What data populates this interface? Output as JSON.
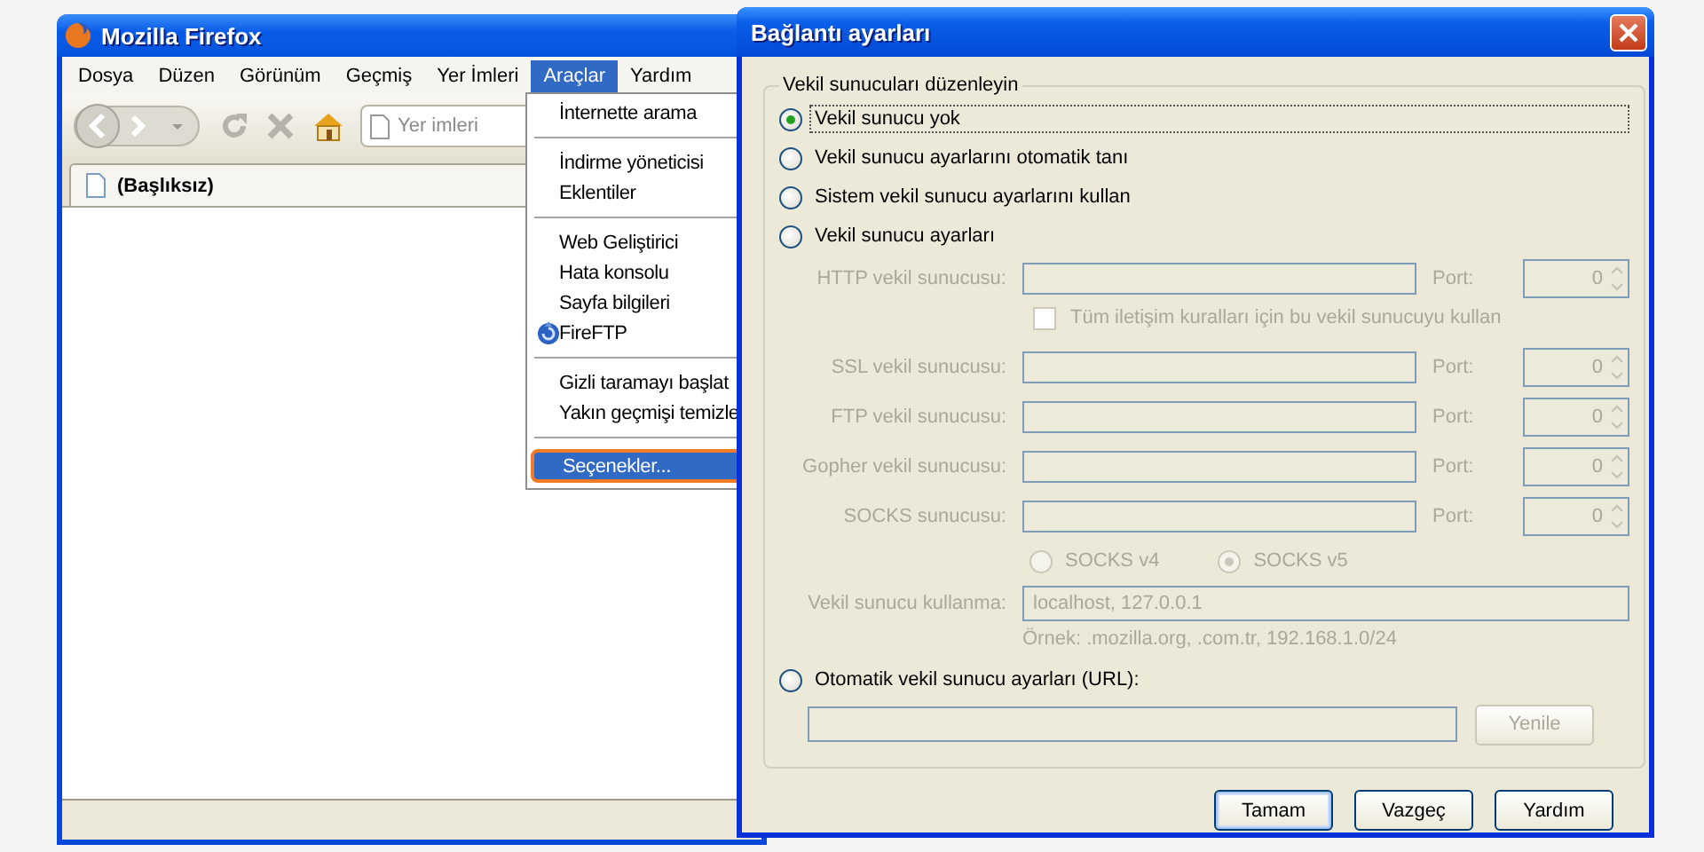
{
  "browser": {
    "title": "Mozilla Firefox",
    "menu": [
      {
        "label": "Dosya",
        "selected": false
      },
      {
        "label": "Düzen",
        "selected": false
      },
      {
        "label": "Görünüm",
        "selected": false
      },
      {
        "label": "Geçmiş",
        "selected": false
      },
      {
        "label": "Yer İmleri",
        "selected": false
      },
      {
        "label": "Araçlar",
        "selected": true
      },
      {
        "label": "Yardım",
        "selected": false
      }
    ],
    "address": {
      "placeholder": "Yer imleri"
    },
    "tabs": [
      {
        "label": "(Başlıksız)",
        "selected": true
      }
    ],
    "tools_menu": [
      {
        "kind": "item",
        "label": "İnternette arama",
        "selected": false
      },
      {
        "kind": "separator"
      },
      {
        "kind": "item",
        "label": "İndirme yöneticisi",
        "selected": false
      },
      {
        "kind": "item",
        "label": "Eklentiler",
        "selected": false
      },
      {
        "kind": "separator"
      },
      {
        "kind": "item",
        "label": "Web Geliştirici",
        "selected": false
      },
      {
        "kind": "item",
        "label": "Hata konsolu",
        "selected": false
      },
      {
        "kind": "item",
        "label": "Sayfa bilgileri",
        "selected": false
      },
      {
        "kind": "app",
        "label": "FireFTP",
        "selected": false
      },
      {
        "kind": "separator"
      },
      {
        "kind": "item",
        "label": "Gizli taramayı başlat",
        "selected": false
      },
      {
        "kind": "item",
        "label": "Yakın geçmişi temizle",
        "selected": false
      },
      {
        "kind": "separator"
      },
      {
        "kind": "item",
        "label": "Seçenekler...",
        "selected": true
      }
    ]
  },
  "dialog": {
    "title": "Bağlantı ayarları",
    "group_title": "Vekil sunucuları düzenleyin",
    "modes": [
      {
        "label": "Vekil sunucu yok",
        "selected": true
      },
      {
        "label": "Vekil sunucu ayarlarını otomatik tanı",
        "selected": false
      },
      {
        "label": "Sistem vekil sunucu ayarlarını kullan",
        "selected": false
      },
      {
        "label": "Vekil sunucu ayarları",
        "selected": false
      }
    ],
    "proxies": [
      {
        "label": "HTTP vekil sunucusu:",
        "port_label": "Port:",
        "port": "0",
        "disabled": true
      },
      {
        "label": "SSL vekil sunucusu:",
        "port_label": "Port:",
        "port": "0",
        "disabled": true
      },
      {
        "label": "FTP vekil sunucusu:",
        "port_label": "Port:",
        "port": "0",
        "disabled": true
      },
      {
        "label": "Gopher vekil sunucusu:",
        "port_label": "Port:",
        "port": "0",
        "disabled": true
      },
      {
        "label": "SOCKS sunucusu:",
        "port_label": "Port:",
        "port": "0",
        "disabled": true
      }
    ],
    "share_all": {
      "label": "Tüm iletişim kuralları için bu vekil sunucuyu kullan",
      "checked": false,
      "disabled": true
    },
    "socks_versions": [
      {
        "label": "SOCKS v4",
        "selected": false,
        "disabled": true
      },
      {
        "label": "SOCKS v5",
        "selected": true,
        "disabled": true
      }
    ],
    "no_proxy": {
      "label": "Vekil sunucu kullanma:",
      "value": "localhost, 127.0.0.1",
      "hint": "Örnek: .mozilla.org, .com.tr, 192.168.1.0/24",
      "disabled": true
    },
    "auto": {
      "label": "Otomatik vekil sunucu ayarları (URL):",
      "selected": false,
      "button": "Yenile",
      "disabled": true
    },
    "buttons": [
      {
        "label": "Tamam",
        "default": true
      },
      {
        "label": "Vazgeç",
        "default": false
      },
      {
        "label": "Yardım",
        "default": false
      }
    ]
  }
}
